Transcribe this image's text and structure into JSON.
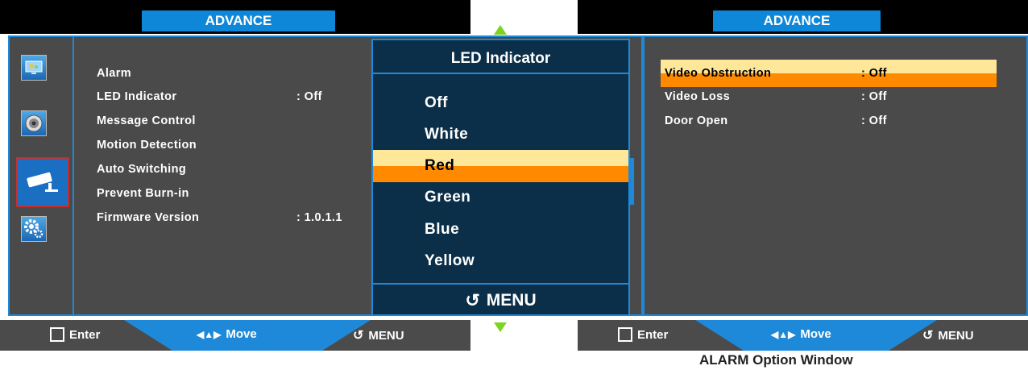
{
  "left_window": {
    "header_title": "ADVANCE",
    "menu": [
      {
        "label": "Alarm",
        "value": ""
      },
      {
        "label": "LED Indicator",
        "value": ": Off"
      },
      {
        "label": "Message Control",
        "value": ""
      },
      {
        "label": "Motion Detection",
        "value": ""
      },
      {
        "label": "Auto Switching",
        "value": ""
      },
      {
        "label": "Prevent Burn-in",
        "value": ""
      },
      {
        "label": "Firmware Version",
        "value": ": 1.0.1.1"
      }
    ],
    "sidebar_icons": [
      "picture-icon",
      "audio-speaker-icon",
      "camera-icon",
      "settings-gears-icon"
    ],
    "footer": {
      "enter": "Enter",
      "move": "Move",
      "menu": "MENU"
    }
  },
  "popup": {
    "title": "LED Indicator",
    "options": [
      "Off",
      "White",
      "Red",
      "Green",
      "Blue",
      "Yellow"
    ],
    "selected_index": 2,
    "footer_label": "MENU"
  },
  "nav_arrows": {
    "up_color": "#7ed321",
    "down_color": "#7ed321"
  },
  "right_window": {
    "header_title": "ADVANCE",
    "menu": [
      {
        "label": "Video Obstruction",
        "value": ": Off"
      },
      {
        "label": "Video Loss",
        "value": ": Off"
      },
      {
        "label": "Door Open",
        "value": ": Off"
      }
    ],
    "selected_index": 0,
    "footer": {
      "enter": "Enter",
      "move": "Move",
      "menu": "MENU"
    },
    "caption": "ALARM Option Window"
  },
  "colors": {
    "accent_blue": "#1f89d9",
    "highlight_orange": "#ff8a00",
    "highlight_yellow": "#ffe79a"
  }
}
